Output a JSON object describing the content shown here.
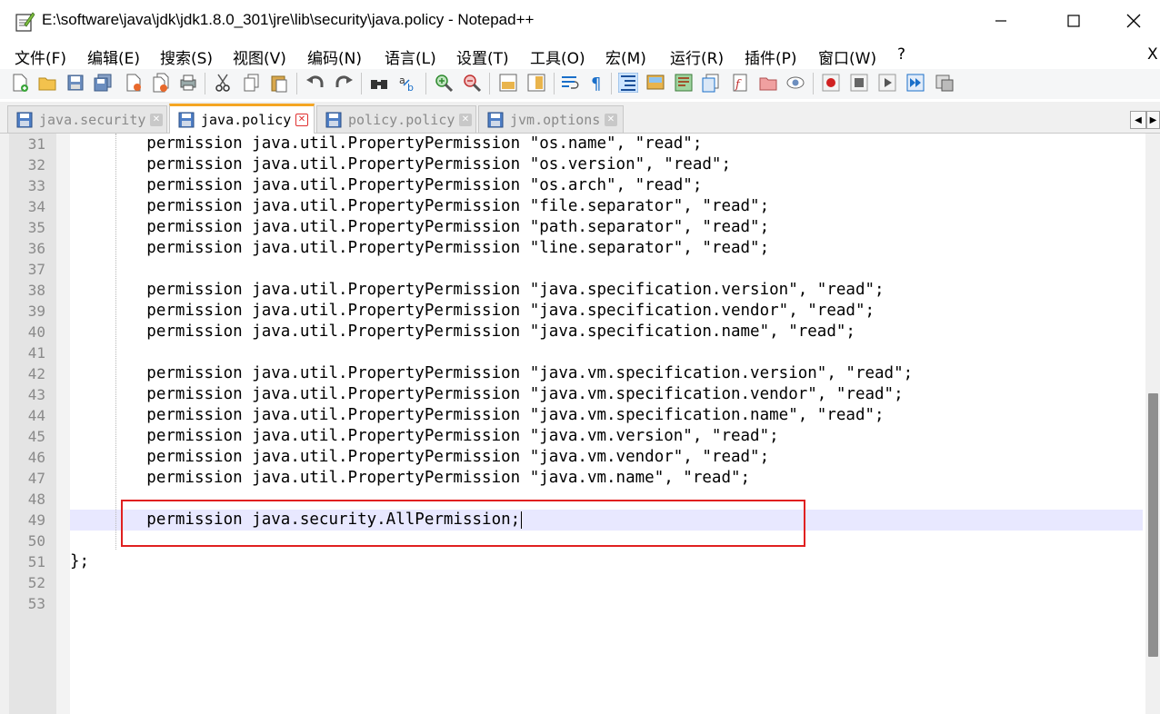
{
  "window": {
    "title": "E:\\software\\java\\jdk\\jdk1.8.0_301\\jre\\lib\\security\\java.policy - Notepad++"
  },
  "menu": {
    "items": [
      "文件(F)",
      "编辑(E)",
      "搜索(S)",
      "视图(V)",
      "编码(N)",
      "语言(L)",
      "设置(T)",
      "工具(O)",
      "宏(M)",
      "运行(R)",
      "插件(P)",
      "窗口(W)",
      "?"
    ],
    "close_x": "X"
  },
  "tabs": [
    {
      "label": "java.security",
      "active": false
    },
    {
      "label": "java.policy",
      "active": true
    },
    {
      "label": "policy.policy",
      "active": false
    },
    {
      "label": "jvm.options",
      "active": false
    }
  ],
  "editor": {
    "current_line": 49,
    "lines": [
      {
        "num": "31",
        "text": "        permission java.util.PropertyPermission \"os.name\", \"read\";"
      },
      {
        "num": "32",
        "text": "        permission java.util.PropertyPermission \"os.version\", \"read\";"
      },
      {
        "num": "33",
        "text": "        permission java.util.PropertyPermission \"os.arch\", \"read\";"
      },
      {
        "num": "34",
        "text": "        permission java.util.PropertyPermission \"file.separator\", \"read\";"
      },
      {
        "num": "35",
        "text": "        permission java.util.PropertyPermission \"path.separator\", \"read\";"
      },
      {
        "num": "36",
        "text": "        permission java.util.PropertyPermission \"line.separator\", \"read\";"
      },
      {
        "num": "37",
        "text": ""
      },
      {
        "num": "38",
        "text": "        permission java.util.PropertyPermission \"java.specification.version\", \"read\";"
      },
      {
        "num": "39",
        "text": "        permission java.util.PropertyPermission \"java.specification.vendor\", \"read\";"
      },
      {
        "num": "40",
        "text": "        permission java.util.PropertyPermission \"java.specification.name\", \"read\";"
      },
      {
        "num": "41",
        "text": ""
      },
      {
        "num": "42",
        "text": "        permission java.util.PropertyPermission \"java.vm.specification.version\", \"read\";"
      },
      {
        "num": "43",
        "text": "        permission java.util.PropertyPermission \"java.vm.specification.vendor\", \"read\";"
      },
      {
        "num": "44",
        "text": "        permission java.util.PropertyPermission \"java.vm.specification.name\", \"read\";"
      },
      {
        "num": "45",
        "text": "        permission java.util.PropertyPermission \"java.vm.version\", \"read\";"
      },
      {
        "num": "46",
        "text": "        permission java.util.PropertyPermission \"java.vm.vendor\", \"read\";"
      },
      {
        "num": "47",
        "text": "        permission java.util.PropertyPermission \"java.vm.name\", \"read\";"
      },
      {
        "num": "48",
        "text": ""
      },
      {
        "num": "49",
        "text": "        permission java.security.AllPermission;"
      },
      {
        "num": "50",
        "text": ""
      },
      {
        "num": "51",
        "text": "};"
      },
      {
        "num": "52",
        "text": ""
      },
      {
        "num": "53",
        "text": ""
      }
    ]
  },
  "colors": {
    "highlight_box": "#e02020",
    "current_line_bg": "#e8e8ff",
    "active_tab_accent": "#f5a623",
    "tab_close_active": "#e03030",
    "tab_close_inactive": "#c8c8c8"
  }
}
